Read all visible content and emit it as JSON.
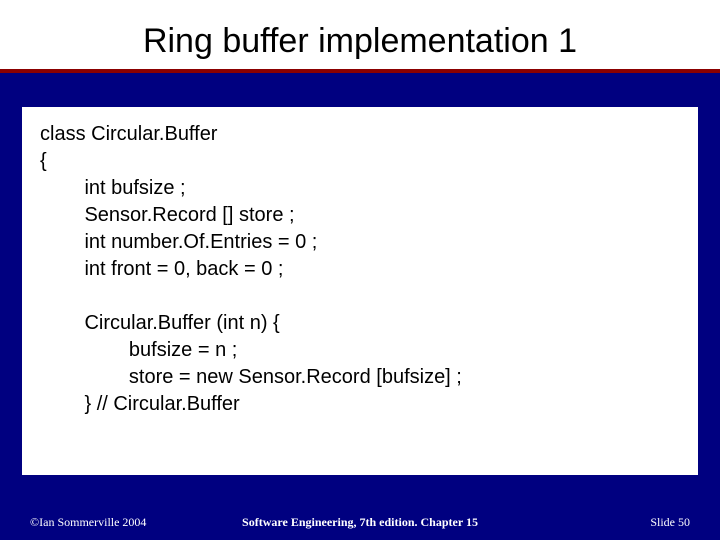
{
  "title": "Ring buffer implementation 1",
  "code": {
    "lines": [
      "class Circular.Buffer",
      "{",
      "        int bufsize ;",
      "        Sensor.Record [] store ;",
      "        int number.Of.Entries = 0 ;",
      "        int front = 0, back = 0 ;",
      "",
      "        Circular.Buffer (int n) {",
      "                bufsize = n ;",
      "                store = new Sensor.Record [bufsize] ;",
      "        } // Circular.Buffer"
    ]
  },
  "footer": {
    "left": "©Ian Sommerville 2004",
    "center": "Software Engineering, 7th edition. Chapter 15",
    "right": "Slide 50"
  }
}
